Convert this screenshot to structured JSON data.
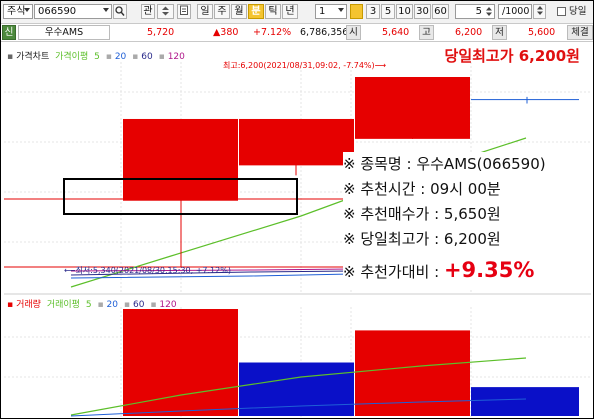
{
  "toolbar": {
    "market": "주식",
    "code": "066590",
    "tool_a": "관",
    "periods": [
      "일",
      "주",
      "월",
      "분",
      "틱",
      "년"
    ],
    "active_period": "분",
    "interval_value": "1",
    "unit_buttons": [
      "3",
      "5",
      "10",
      "30",
      "60"
    ],
    "compare_value": "5",
    "count_value": "1000",
    "checkbox_label": "당일"
  },
  "info": {
    "label_new": "신",
    "stock_name": "우수AMS",
    "price": "5,720",
    "change": "▲380",
    "change_pct": "+7.12%",
    "volume": "6,786,356",
    "open_label": "시",
    "open": "5,640",
    "high_label": "고",
    "high": "6,200",
    "low_label": "저",
    "low": "5,600",
    "trade_label": "체결"
  },
  "legend_price": {
    "name": "가격차트",
    "ma_label": "가격이평",
    "ma_periods": [
      "5",
      "20",
      "60",
      "120"
    ]
  },
  "legend_volume": {
    "name": "거래량",
    "ma_label": "거래이평",
    "ma_periods": [
      "5",
      "20",
      "60",
      "120"
    ]
  },
  "chart": {
    "high_annotation": "최고:6,200(2021/08/31,09:02, -7.74%)⟶",
    "low_annotation": "⟵최저:5,340(2021/08/30,15:30, +7.12%)"
  },
  "overlay": {
    "title": "당일최고가 6,200원",
    "lines": [
      "※ 종목명 : 우수AMS(066590)",
      "※ 추천시간 : 09시 00분",
      "※ 추천매수가 : 5,650원",
      "※ 당일최고가 : 6,200원"
    ],
    "ratio_label": "※ 추천가대비 : ",
    "ratio_value": "+9.35%"
  },
  "colors": {
    "up": "#e60000",
    "down": "#0a10c8",
    "ma5": "#5cbf2a",
    "ma20": "#1f5fd6",
    "ma60": "#2a2a8a",
    "ma120": "#b0178a",
    "highlight": "#e01010"
  },
  "chart_data": {
    "type": "candlestick",
    "candles": [
      {
        "open": 5640,
        "high": 6010,
        "low": 5340,
        "close": 6010
      },
      {
        "open": 6010,
        "high": 6010,
        "low": 5800,
        "close": 5800
      },
      {
        "open": 5920,
        "high": 6200,
        "low": 5920,
        "close": 6200
      },
      {
        "open": 6100,
        "high": 6110,
        "low": 6080,
        "close": 6100
      }
    ],
    "volume": [
      {
        "value": 100,
        "dir": "up"
      },
      {
        "value": 50,
        "dir": "down"
      },
      {
        "value": 80,
        "dir": "up"
      },
      {
        "value": 27,
        "dir": "down"
      }
    ]
  }
}
